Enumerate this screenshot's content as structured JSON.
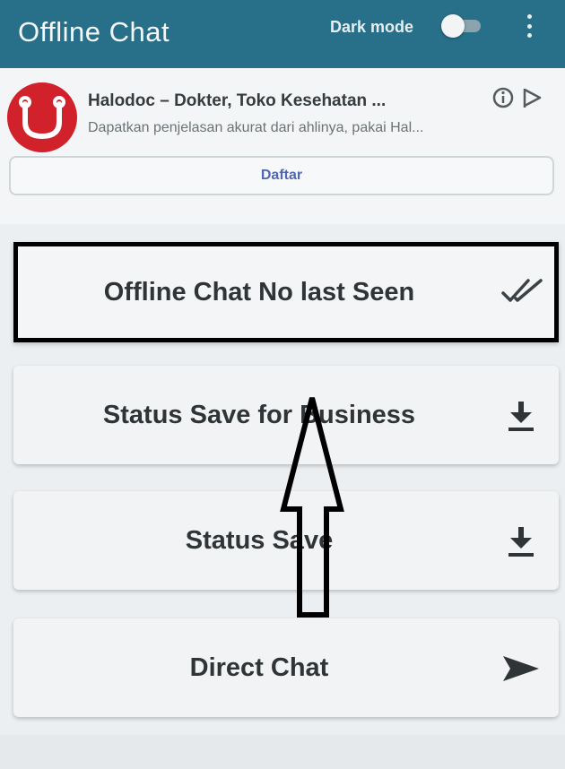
{
  "app": {
    "title": "Offline Chat"
  },
  "header": {
    "dark_mode_label": "Dark mode",
    "dark_mode_on": false
  },
  "ad": {
    "title": "Halodoc – Dokter, Toko Kesehatan ...",
    "description": "Dapatkan penjelasan akurat dari ahlinya, pakai Hal...",
    "cta": "Daftar",
    "brand_color": "#d1222c"
  },
  "menu": {
    "items": [
      {
        "label": "Offline Chat No last Seen",
        "icon": "double-check-icon"
      },
      {
        "label": "Status Save for Business",
        "icon": "download-icon"
      },
      {
        "label": "Status Save",
        "icon": "download-icon"
      },
      {
        "label": "Direct Chat",
        "icon": "send-icon"
      }
    ]
  },
  "colors": {
    "accent": "#28708a",
    "highlight_border": "#000000"
  }
}
